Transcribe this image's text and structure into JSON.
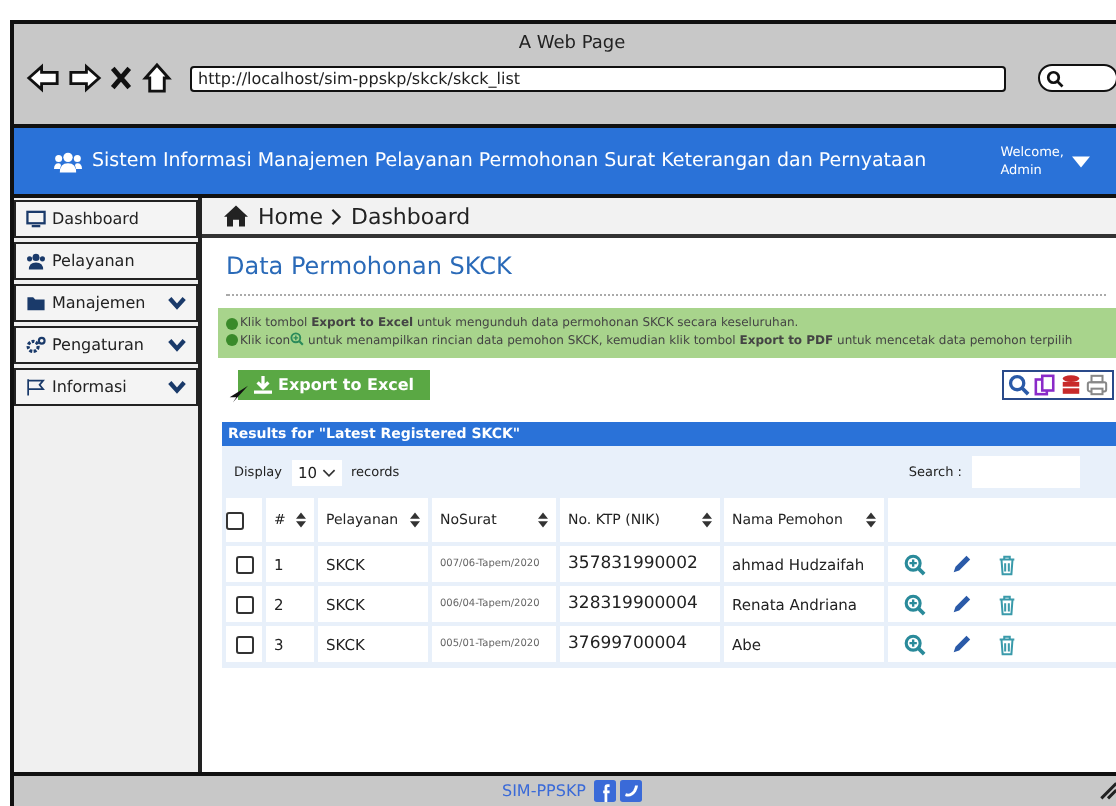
{
  "window": {
    "title": "A Web Page",
    "url": "http://localhost/sim-ppskp/skck/skck_list"
  },
  "header": {
    "title": "Sistem Informasi Manajemen Pelayanan Permohonan Surat Keterangan dan Pernyataan",
    "user": [
      "Welcome,",
      "Admin"
    ]
  },
  "sidebar": {
    "items": [
      {
        "label": "Dashboard",
        "submenu": false
      },
      {
        "label": "Pelayanan",
        "submenu": false
      },
      {
        "label": "Manajemen",
        "submenu": true
      },
      {
        "label": "Pengaturan",
        "submenu": true
      },
      {
        "label": "Informasi",
        "submenu": true
      }
    ]
  },
  "breadcrumb": [
    "Home",
    "Dashboard"
  ],
  "page_title": "Data Permohonan SKCK",
  "info": [
    {
      "before": "Klik tombol **Export to Excel** untuk mengunduh data permohonan SKCK secara keseluruhan."
    },
    {
      "before": "Klik icon",
      "after": "untuk menampilkan rincian data pemohon SKCK, kemudian klik tombol **Export to PDF** untuk mencetak data pemohon terpilih"
    }
  ],
  "export_button": "Export to Excel",
  "results_title": "Results for \"Latest Registered SKCK\"",
  "table": {
    "select_all_checked": false,
    "display_label": "Display",
    "page_size": "10",
    "records_label": "records",
    "search_label": "Search :",
    "columns": [
      "#",
      "Pelayanan",
      "NoSurat",
      "No. KTP (NIK)",
      "Nama Pemohon"
    ],
    "rows": [
      {
        "checked": false,
        "cells": [
          "1",
          "SKCK",
          "007/06-Tapem/2020",
          "357831990002",
          "ahmad Hudzaifah"
        ]
      },
      {
        "checked": false,
        "cells": [
          "2",
          "SKCK",
          "006/04-Tapem/2020",
          "328319900004",
          "Renata Andriana"
        ]
      },
      {
        "checked": false,
        "cells": [
          "3",
          "SKCK",
          "005/01-Tapem/2020",
          "37699700004",
          "Abe"
        ]
      }
    ]
  },
  "footer": {
    "text": "SIM-PPSKP"
  }
}
